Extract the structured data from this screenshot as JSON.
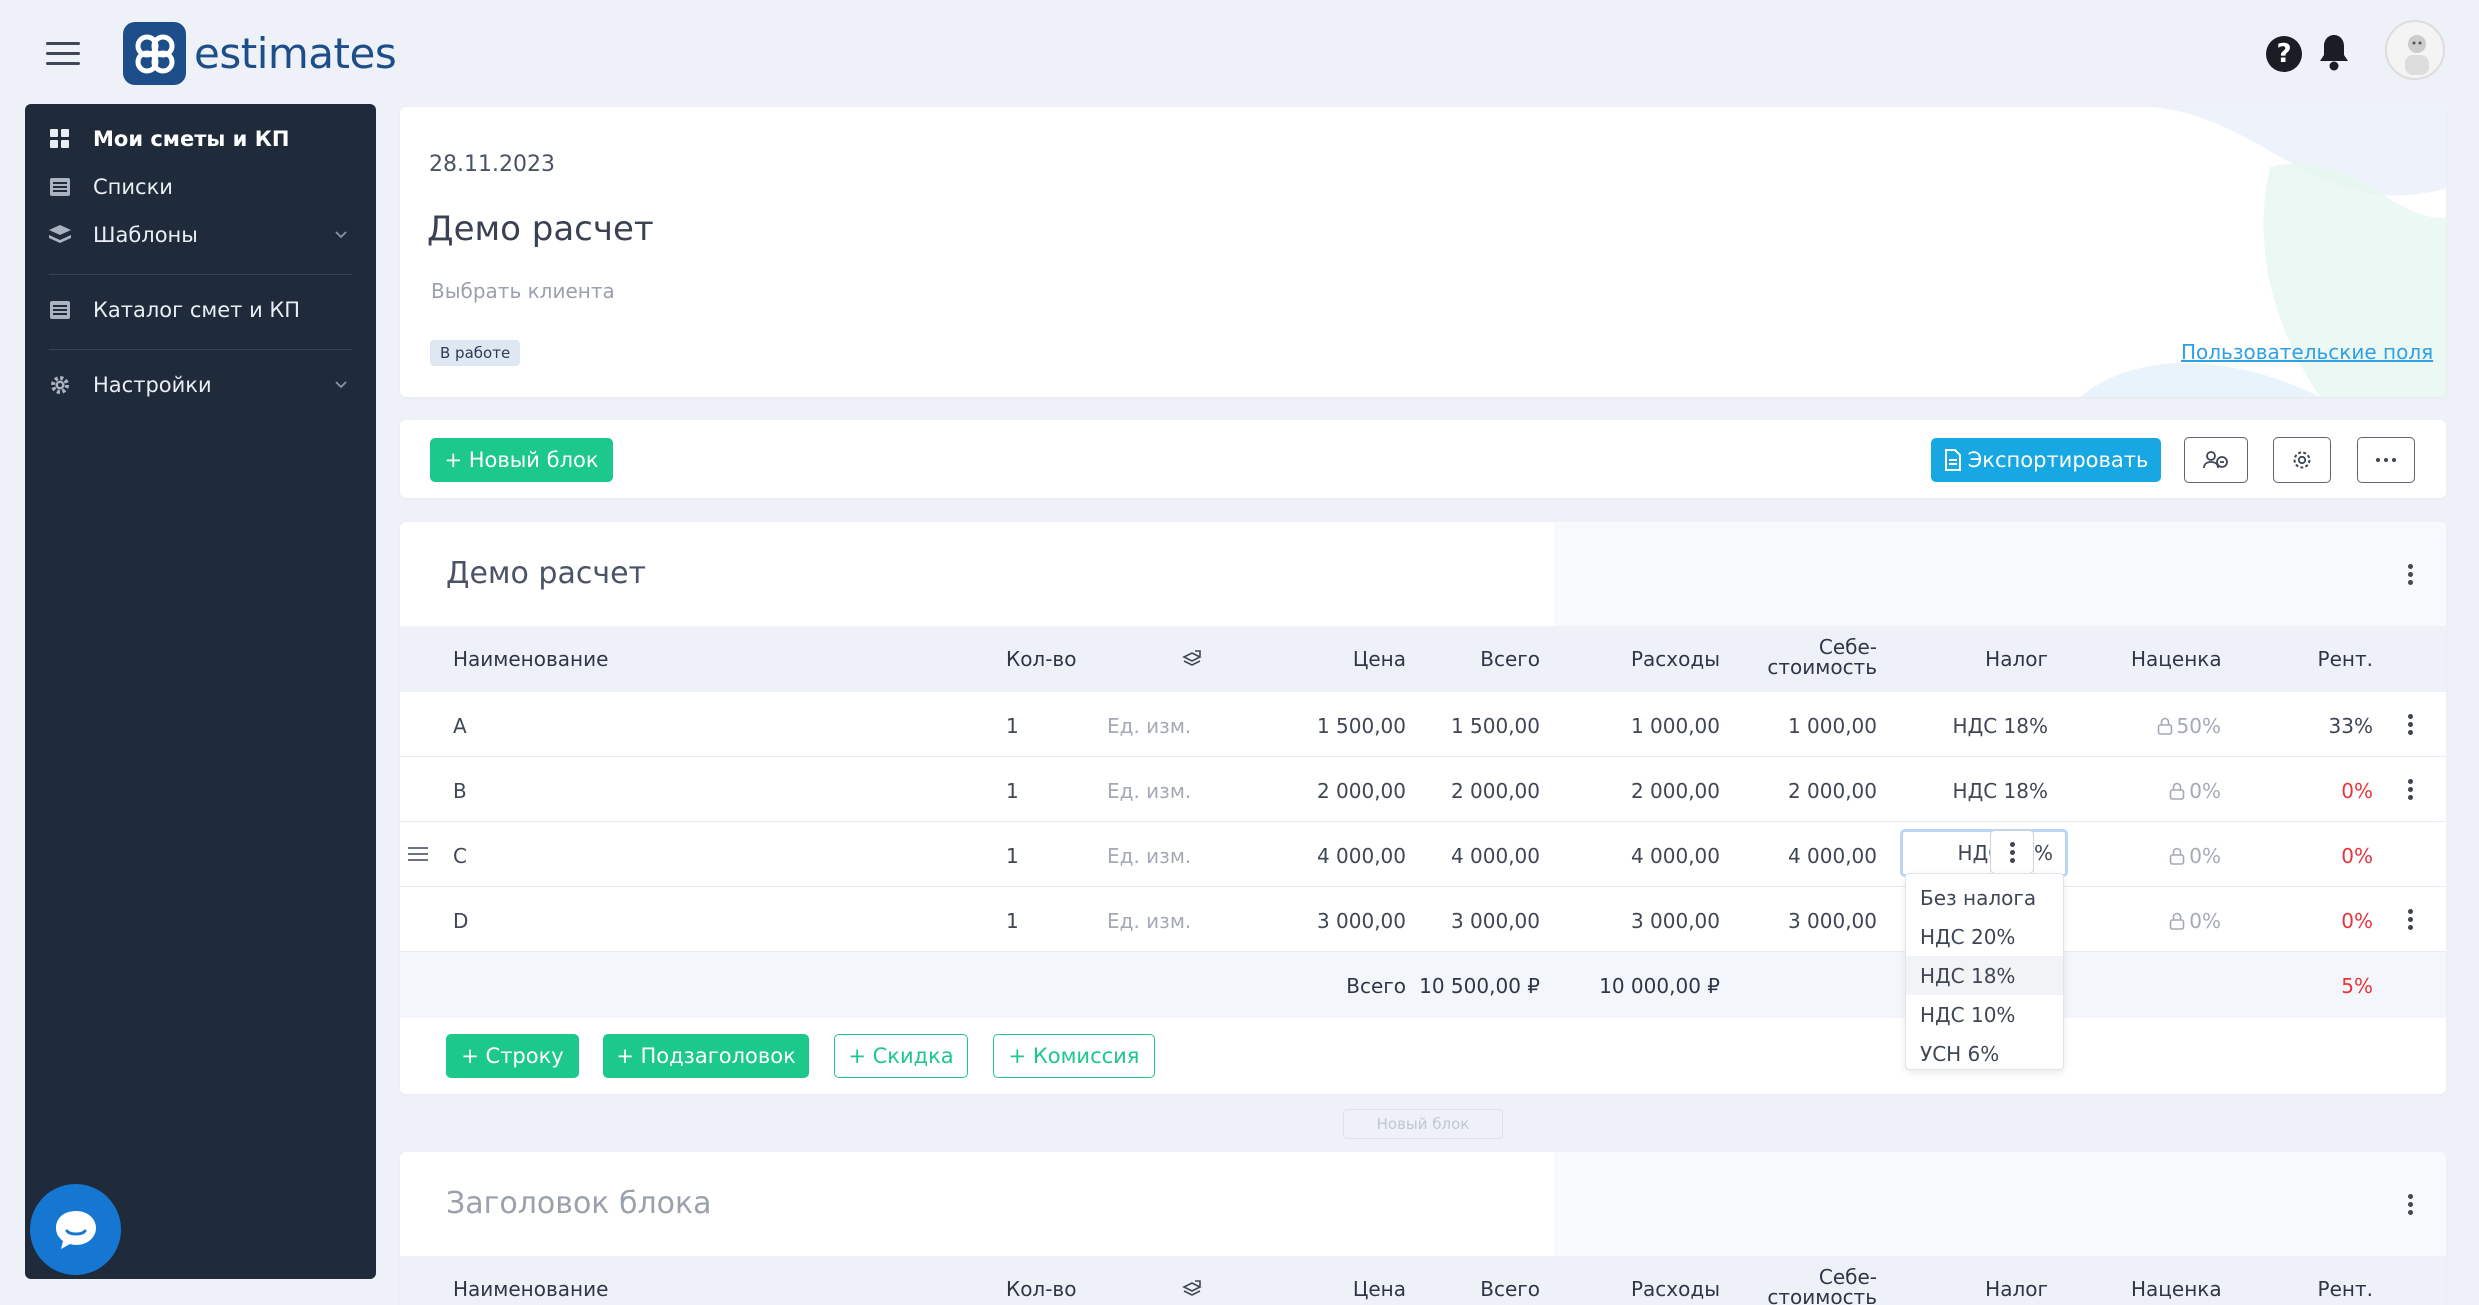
{
  "app": {
    "logo_text": "estimates"
  },
  "sidebar": {
    "items": [
      {
        "label": "Мои сметы и КП"
      },
      {
        "label": "Списки"
      },
      {
        "label": "Шаблоны"
      },
      {
        "label": "Каталог смет и КП"
      },
      {
        "label": "Настройки"
      }
    ]
  },
  "header": {
    "date": "28.11.2023",
    "title": "Демо расчет",
    "client_placeholder": "Выбрать клиента",
    "status": "В работе",
    "custom_fields_link": "Пользовательские поля"
  },
  "toolbar": {
    "new_block": "+ Новый блок",
    "export": "Экспортировать"
  },
  "table": {
    "columns": [
      "Наименование",
      "Кол-во",
      "Цена",
      "Всего",
      "Расходы",
      "Себе-",
      "стоимость",
      "Налог",
      "Наценка",
      "Рент."
    ]
  },
  "block1": {
    "title": "Демо расчет",
    "rows": [
      {
        "name": "A",
        "qty": "1",
        "unit": "Ед. изм.",
        "price": "1 500,00",
        "total": "1 500,00",
        "expenses": "1 000,00",
        "cost": "1 000,00",
        "tax": "НДС 18%",
        "markup": "50%",
        "profit": "33%"
      },
      {
        "name": "B",
        "qty": "1",
        "unit": "Ед. изм.",
        "price": "2 000,00",
        "total": "2 000,00",
        "expenses": "2 000,00",
        "cost": "2 000,00",
        "tax": "НДС 18%",
        "markup": "0%",
        "profit": "0%"
      },
      {
        "name": "C",
        "qty": "1",
        "unit": "Ед. изм.",
        "price": "4 000,00",
        "total": "4 000,00",
        "expenses": "4 000,00",
        "cost": "4 000,00",
        "tax": "НДС 18%",
        "markup": "0%",
        "profit": "0%"
      },
      {
        "name": "D",
        "qty": "1",
        "unit": "Ед. изм.",
        "price": "3 000,00",
        "total": "3 000,00",
        "expenses": "3 000,00",
        "cost": "3 000,00",
        "tax": "",
        "markup": "0%",
        "profit": "0%"
      }
    ],
    "totals": {
      "label": "Всего",
      "total": "10 500,00 ₽",
      "expenses": "10 000,00 ₽",
      "profit": "5%"
    },
    "add_buttons": [
      "+ Строку",
      "+ Подзаголовок",
      "+ Скидка",
      "+ Комиссия"
    ]
  },
  "tax_dropdown": {
    "selected": "НДС 18%",
    "options": [
      "Без налога",
      "НДС 20%",
      "НДС 18%",
      "НДС 10%",
      "УСН 6%"
    ]
  },
  "new_block_ghost": "Новый блок",
  "block2": {
    "title": "Заголовок блока"
  },
  "colors": {
    "green": "#1cc88a",
    "blue": "#17a8e3",
    "sidebar": "#1f2a3a",
    "red": "#e8343c"
  }
}
